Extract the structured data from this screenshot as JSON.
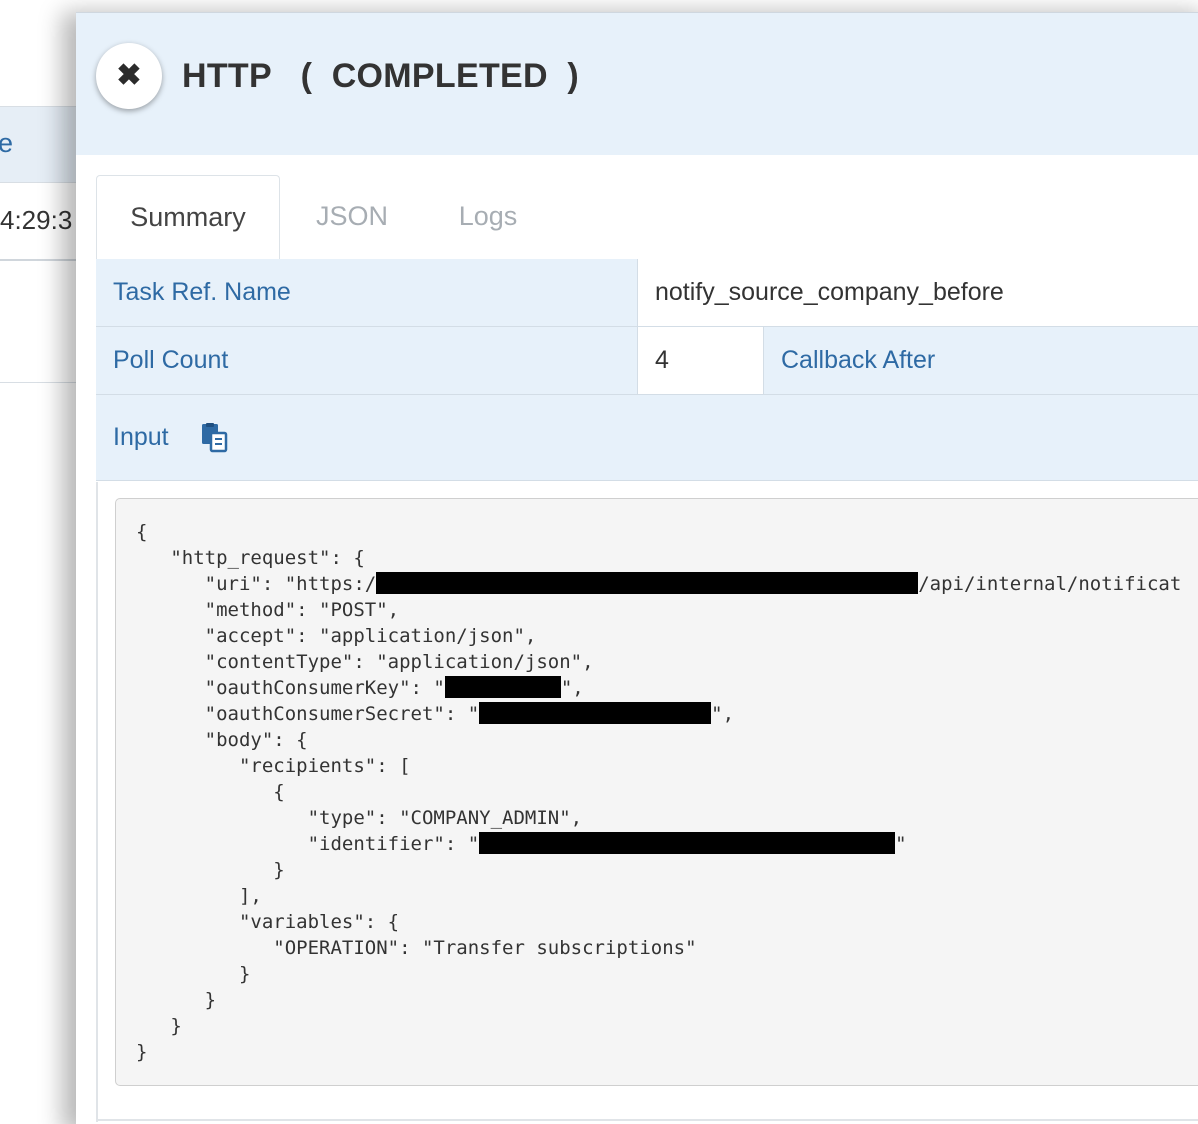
{
  "background": {
    "header_fragment": "e",
    "time_fragment": "4:29:3"
  },
  "modal": {
    "close_symbol": "✖",
    "title": "HTTP   (  COMPLETED  )"
  },
  "tabs": [
    {
      "label": "Summary",
      "active": true
    },
    {
      "label": "JSON",
      "active": false
    },
    {
      "label": "Logs",
      "active": false
    }
  ],
  "summary": {
    "task_ref_label": "Task Ref. Name",
    "task_ref_value": "notify_source_company_before",
    "poll_count_label": "Poll Count",
    "poll_count_value": "4",
    "callback_after_label": "Callback After",
    "input_label": "Input"
  },
  "input_json": {
    "line1": "{",
    "line2": "   \"http_request\": {",
    "line3_pre": "      \"uri\": \"https:/",
    "line3_post": "/api/internal/notificat",
    "line4": "      \"method\": \"POST\",",
    "line5": "      \"accept\": \"application/json\",",
    "line6": "      \"contentType\": \"application/json\",",
    "line7_pre": "      \"oauthConsumerKey\": \"",
    "line7_post": "\",",
    "line8_pre": "      \"oauthConsumerSecret\": \"",
    "line8_post": "\",",
    "line9": "      \"body\": {",
    "line10": "         \"recipients\": [",
    "line11": "            {",
    "line12": "               \"type\": \"COMPANY_ADMIN\",",
    "line13_pre": "               \"identifier\": \"",
    "line13_post": "\"",
    "line14": "            }",
    "line15": "         ],",
    "line16": "         \"variables\": {",
    "line17": "            \"OPERATION\": \"Transfer subscriptions\"",
    "line18": "         }",
    "line19": "      }",
    "line20": "   }",
    "line21": "}"
  },
  "colors": {
    "label_blue": "#2e6aa4",
    "header_bg": "#e7f1fa",
    "tab_inactive": "#a7adb3"
  },
  "icons": {
    "close": "close-icon",
    "copy": "clipboard-copy-icon"
  }
}
